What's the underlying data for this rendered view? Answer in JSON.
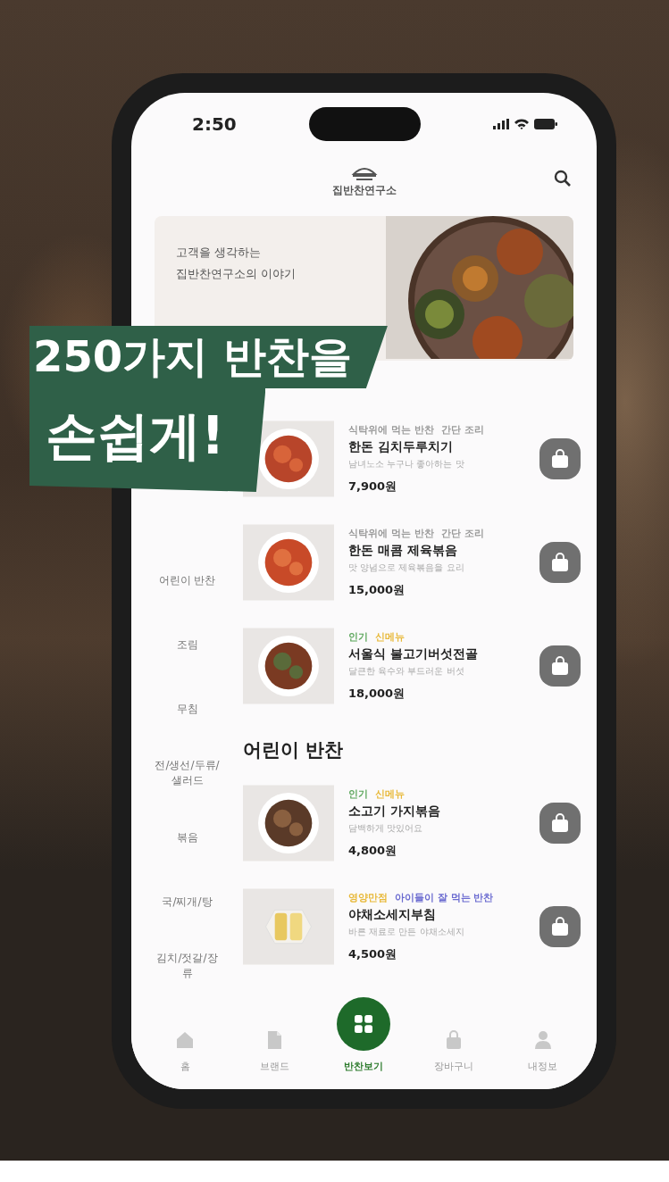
{
  "status_bar": {
    "time": "2:50"
  },
  "header": {
    "logo_text": "집반찬연구소"
  },
  "hero": {
    "lines": [
      "고객을 생각하는",
      "집반찬연구소의 이야기"
    ]
  },
  "overlay": {
    "lines": [
      "250가지 반찬을",
      "손쉽게!"
    ]
  },
  "sidebar": {
    "items": [
      {
        "label": "어린이 반찬",
        "selected": false
      },
      {
        "label": "조림",
        "selected": false
      },
      {
        "label": "무침",
        "selected": false
      },
      {
        "label": "전/생선/두류/샐러드",
        "selected": false
      },
      {
        "label": "볶음",
        "selected": false
      },
      {
        "label": "국/찌개/탕",
        "selected": false
      },
      {
        "label": "김치/젓갈/장류",
        "selected": false
      }
    ]
  },
  "sections": [
    {
      "products": [
        {
          "tags": [
            {
              "label": "식탁위에 먹는 반찬",
              "color": "#9a9a9a"
            },
            {
              "label": "간단 조리",
              "color": "#9a9a9a"
            }
          ],
          "name": "한돈 김치두루치기",
          "description": "남녀노소 누구나 좋아하는 맛",
          "price": "7,900원"
        },
        {
          "tags": [
            {
              "label": "식탁위에 먹는 반찬",
              "color": "#9a9a9a"
            },
            {
              "label": "간단 조리",
              "color": "#9a9a9a"
            }
          ],
          "name": "한돈 매콤 제육볶음",
          "description": "맛 양념으로 제육볶음을 요리",
          "price": "15,000원"
        },
        {
          "tags": [
            {
              "label": "인기",
              "color": "#5aa55a"
            },
            {
              "label": "신메뉴",
              "color": "#e8b93a"
            }
          ],
          "name": "서울식 불고기버섯전골",
          "description": "달큰한 육수와 부드러운 버섯",
          "price": "18,000원"
        }
      ]
    },
    {
      "title": "어린이 반찬",
      "products": [
        {
          "tags": [
            {
              "label": "인기",
              "color": "#5aa55a"
            },
            {
              "label": "신메뉴",
              "color": "#e8b93a"
            }
          ],
          "name": "소고기 가지볶음",
          "description": "담백하게 맛있어요",
          "price": "4,800원"
        },
        {
          "tags": [
            {
              "label": "영양만점",
              "color": "#e8b93a"
            },
            {
              "label": "아이들이 잘 먹는 반찬",
              "color": "#6a6ad0"
            }
          ],
          "name": "야채소세지부침",
          "description": "바른 재료로 만든 야채소세지",
          "price": "4,500원"
        }
      ]
    }
  ],
  "bottom_nav": [
    {
      "label": "홈",
      "kind": "home",
      "selected": false
    },
    {
      "label": "브랜드",
      "kind": "brand",
      "selected": false
    },
    {
      "label": "반찬보기",
      "kind": "menu",
      "selected": true
    },
    {
      "label": "장바구니",
      "kind": "cart",
      "selected": false
    },
    {
      "label": "내정보",
      "kind": "profile",
      "selected": false
    }
  ]
}
